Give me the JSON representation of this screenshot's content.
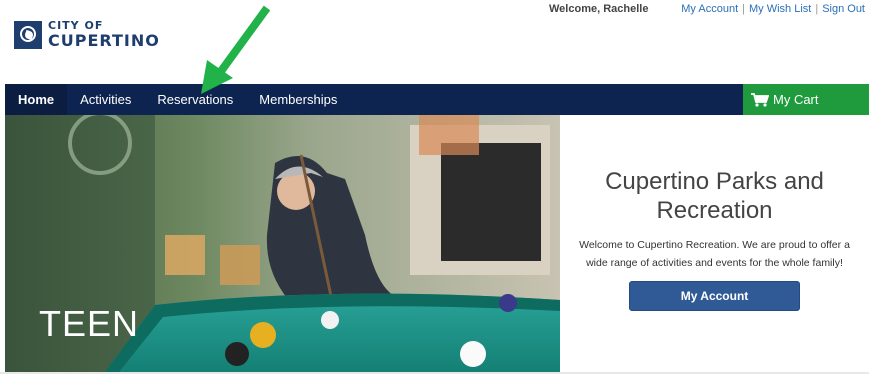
{
  "brand": {
    "line1": "CITY OF",
    "line2": "CUPERTINO",
    "color": "#1f3e6e"
  },
  "header": {
    "welcome": "Welcome, Rachelle",
    "links": [
      "My Account",
      "My Wish List",
      "Sign Out"
    ],
    "separator": "|"
  },
  "nav": {
    "items": [
      "Home",
      "Activities",
      "Reservations",
      "Memberships"
    ],
    "active": "Home",
    "background": "#0e2450",
    "cart_label": "My Cart",
    "cart_color": "#1f9b3d"
  },
  "annotation": {
    "arrow_color": "#21b24a",
    "points_to": "Reservations"
  },
  "hero": {
    "image_label": "TEEN",
    "title": "Cupertino Parks and Recreation",
    "description": "Welcome to Cupertino Recreation. We are proud to offer a wide range of activities and events for the whole family!",
    "button_label": "My Account",
    "button_color": "#2f5a96"
  }
}
